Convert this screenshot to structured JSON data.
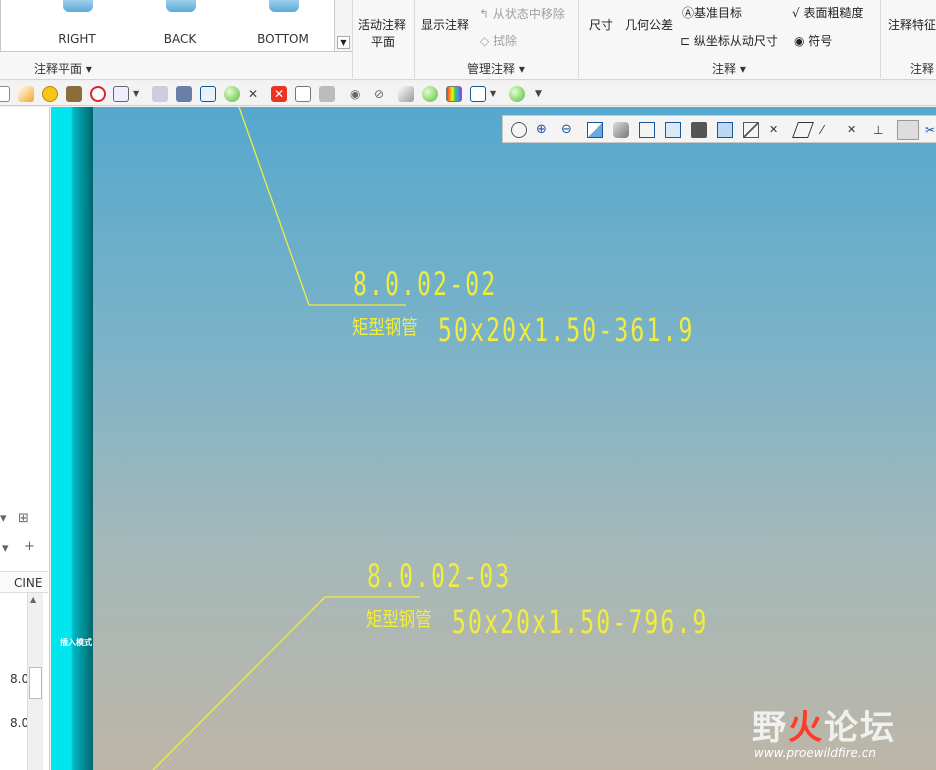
{
  "ribbon": {
    "views": [
      "RIGHT",
      "BACK",
      "BOTTOM"
    ],
    "groups": {
      "annotation_plane": "注释平面",
      "manage": "管理注释",
      "annotations": "注释",
      "features": "注释"
    },
    "buttons": {
      "active_plane_1": "活动注释",
      "active_plane_2": "平面",
      "show_annotation": "显示注释",
      "remove_from_state": "从状态中移除",
      "erase": "拭除",
      "dimension": "尺寸",
      "geometric_tolerance": "几何公差",
      "datum_target": "基准目标",
      "ordinate_dimension": "纵坐标从动尺寸",
      "surface_finish": "表面粗糙度",
      "symbol": "符号",
      "annotation_feature": "注释特征"
    }
  },
  "left_panel": {
    "column_header": "CINE",
    "rows": [
      "8.0",
      "8.0"
    ]
  },
  "strip_label": "插入模式",
  "notes": [
    {
      "id": "8.0.02-02",
      "name": "矩型钢管",
      "dims": "50x20x1.50-361.9"
    },
    {
      "id": "8.0.02-03",
      "name": "矩型钢管",
      "dims": "50x20x1.50-796.9"
    }
  ],
  "watermark": {
    "main_a": "野",
    "main_b": "火",
    "main_c": "论坛",
    "url": "www.proewildfire.cn"
  },
  "colors": {
    "annotation": "#f2ec3c",
    "cyan_strip": "#00e5ee",
    "watermark_accent": "#ff3a2a"
  }
}
